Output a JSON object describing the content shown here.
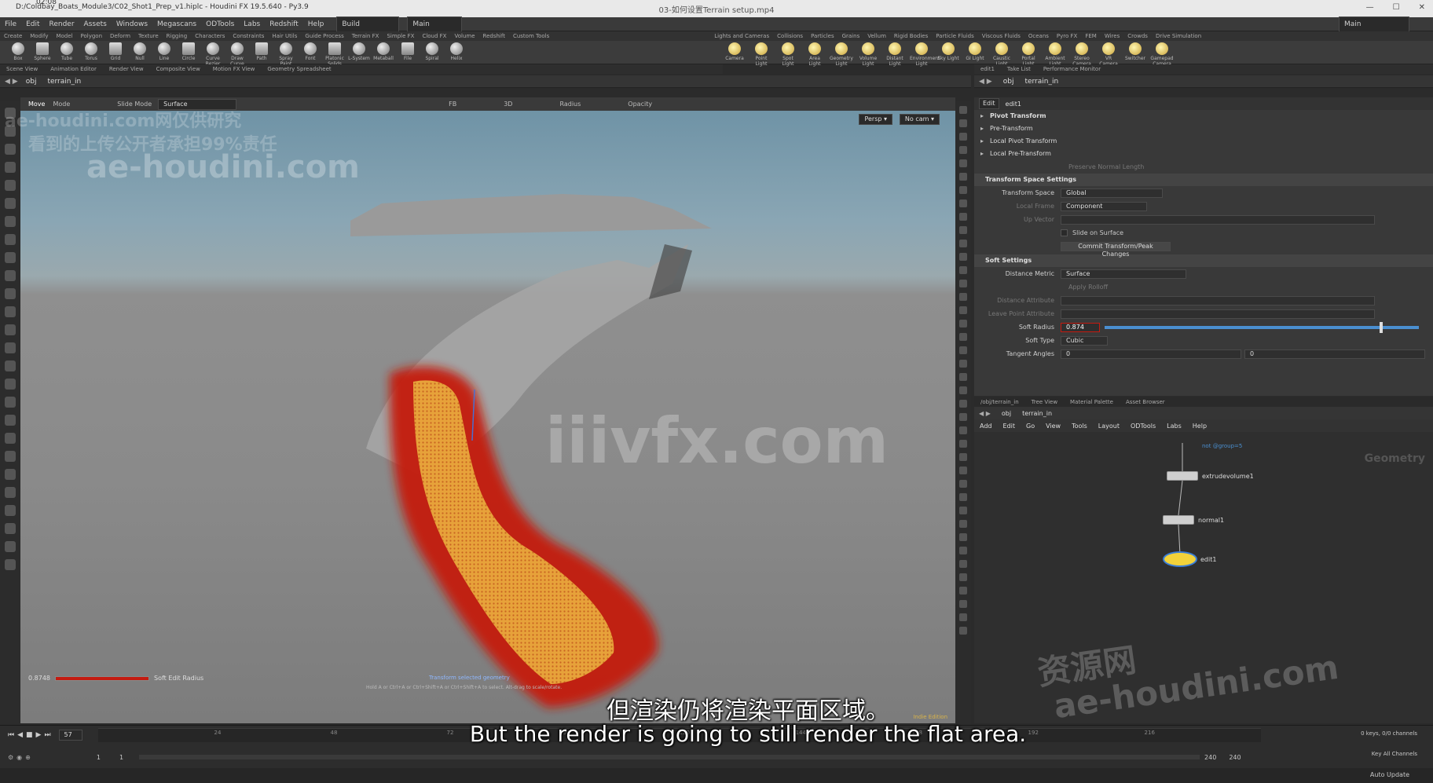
{
  "window": {
    "app_path": "D:/Coldbay_Boats_Module3/C02_Shot1_Prep_v1.hiplc - Houdini FX 19.5.640 - Py3.9",
    "video_title": "03-如何设置Terrain setup.mp4",
    "timestamp": "02:08",
    "desktop": "Main"
  },
  "menu": [
    "File",
    "Edit",
    "Render",
    "Assets",
    "Windows",
    "Megascans",
    "ODTools",
    "Labs",
    "Redshift",
    "Help"
  ],
  "desktop_build": "Build",
  "desktop_main": "Main",
  "shelf_tabs_left": [
    "Create",
    "Modify",
    "Model",
    "Polygon",
    "Deform",
    "Texture",
    "Rigging",
    "Characters",
    "Constraints",
    "Hair Utils",
    "Guide Process",
    "Terrain FX",
    "Simple FX",
    "Cloud FX",
    "Volume",
    "Redshift",
    "Custom Tools"
  ],
  "shelf_tabs_right": [
    "Lights and Cameras",
    "Collisions",
    "Particles",
    "Grains",
    "Vellum",
    "Rigid Bodies",
    "Particle Fluids",
    "Viscous Fluids",
    "Oceans",
    "Pyro FX",
    "FEM",
    "Wires",
    "Crowds",
    "Drive Simulation"
  ],
  "shelf_tools_left": [
    "Box",
    "Sphere",
    "Tube",
    "Torus",
    "Grid",
    "Null",
    "Line",
    "Circle",
    "Curve Bezier",
    "Draw Curve",
    "Path",
    "Spray Paint",
    "Font",
    "Platonic Solids",
    "L-System",
    "Metaball",
    "File",
    "Spiral",
    "Helix"
  ],
  "shelf_tools_right": [
    "Camera",
    "Point Light",
    "Spot Light",
    "Area Light",
    "Geometry Light",
    "Volume Light",
    "Distant Light",
    "Environment Light",
    "Sky Light",
    "GI Light",
    "Caustic Light",
    "Portal Light",
    "Ambient Light",
    "Stereo Camera",
    "VR Camera",
    "Switcher",
    "Gamepad Camera"
  ],
  "pane_tabs_left": [
    "Scene View",
    "Animation Editor",
    "Render View",
    "Composite View",
    "Motion FX View",
    "Geometry Spreadsheet"
  ],
  "pane_tabs_right_top": [
    "edit1",
    "Take List",
    "Performance Monitor"
  ],
  "path_left": {
    "obj": "obj",
    "node": "terrain_in"
  },
  "path_right": {
    "obj": "obj",
    "node": "terrain_in"
  },
  "viewport_toolbar": {
    "move": "Move",
    "mode": "Mode",
    "slide_mode": "Slide Mode",
    "surface": "Surface",
    "fb": "FB",
    "threed": "3D",
    "radius": "Radius",
    "opacity": "Opacity"
  },
  "viewport_cam": {
    "persp": "Persp ▾",
    "nocam": "No cam ▾"
  },
  "viewport_hud": {
    "radius_value": "0.8748",
    "radius_label": "Soft Edit Radius",
    "transform_label": "Transform selected geometry",
    "hint": "Hold A or Ctrl+A or Ctrl+Shift+A or Ctrl+Shift+A to select. Alt-drag to scale/rotate.",
    "indie": "Indie Edition"
  },
  "params": {
    "header": "Edit",
    "node_name": "edit1",
    "sections": [
      "Pivot Transform",
      "Pre-Transform",
      "Local Pivot Transform",
      "Local Pre-Transform"
    ],
    "preserve": "Preserve Normal Length",
    "tss_title": "Transform Space Settings",
    "transform_space_label": "Transform Space",
    "transform_space_value": "Global",
    "local_frame_label": "Local Frame",
    "local_frame_value": "Component",
    "up_vector_label": "Up Vector",
    "slide_on_surface": "Slide on Surface",
    "commit_button": "Commit Transform/Peak Changes",
    "soft_title": "Soft Settings",
    "distance_metric_label": "Distance Metric",
    "distance_metric_value": "Surface",
    "apply_rolloff": "Apply Rolloff",
    "distance_attr_label": "Distance Attribute",
    "leave_point_label": "Leave Point Attribute",
    "soft_radius_label": "Soft Radius",
    "soft_radius_value": "0.874",
    "soft_radius_fraction": 0.874,
    "soft_type_label": "Soft Type",
    "soft_type_value": "Cubic",
    "tangent_label": "Tangent Angles",
    "tangent_a": "0",
    "tangent_b": "0"
  },
  "net_tabs": [
    "/obj/terrain_in",
    "Tree View",
    "Material Palette",
    "Asset Browser"
  ],
  "net_menu": [
    "Add",
    "Edit",
    "Go",
    "View",
    "Tools",
    "Layout",
    "ODTools",
    "Labs",
    "Help"
  ],
  "net_context": "Geometry",
  "nodes": [
    {
      "name": "extrudevolume1",
      "sub": "",
      "label_above": "not @group=5"
    },
    {
      "name": "normal1"
    },
    {
      "name": "edit1"
    }
  ],
  "timeline": {
    "frame": "57",
    "start": "1",
    "start2": "1",
    "end": "240",
    "end2": "240",
    "ticks": [
      "",
      "24",
      "48",
      "72",
      "96",
      "120",
      "144",
      "168",
      "192",
      "216"
    ],
    "keys_label": "0 keys, 0/0 channels",
    "key_all": "Key All Channels"
  },
  "status": {
    "auto_update": "Auto Update"
  },
  "watermarks": {
    "wm1_a": "ae-houdini.com网仅供研究",
    "wm1_b": "看到的上传公开者承担99%责任",
    "wm2": "ae-houdini.com",
    "wm3": "iiivfx.com",
    "wm4_a": "资源网",
    "wm4_b": "ae-houdini.com"
  },
  "subtitles": {
    "zh": "但渲染仍将渲染平面区域。",
    "en": "But the render is going to still render the flat area."
  },
  "colors": {
    "node_selected": "#f2d23a",
    "heat_red": "#c21a10",
    "heat_orange": "#e8a13a",
    "accent_blue": "#4a8fd0"
  }
}
